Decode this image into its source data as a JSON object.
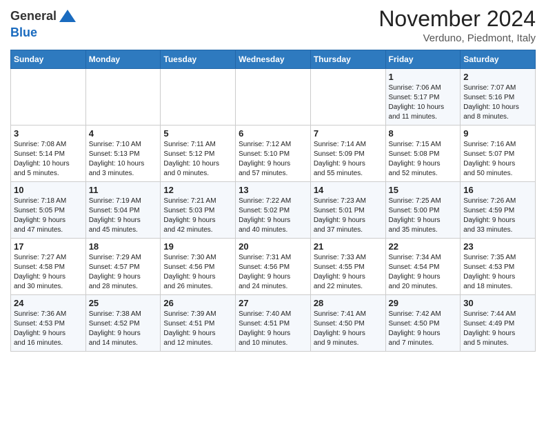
{
  "header": {
    "logo_general": "General",
    "logo_blue": "Blue",
    "month_title": "November 2024",
    "location": "Verduno, Piedmont, Italy"
  },
  "weekdays": [
    "Sunday",
    "Monday",
    "Tuesday",
    "Wednesday",
    "Thursday",
    "Friday",
    "Saturday"
  ],
  "weeks": [
    [
      {
        "day": "",
        "info": ""
      },
      {
        "day": "",
        "info": ""
      },
      {
        "day": "",
        "info": ""
      },
      {
        "day": "",
        "info": ""
      },
      {
        "day": "",
        "info": ""
      },
      {
        "day": "1",
        "info": "Sunrise: 7:06 AM\nSunset: 5:17 PM\nDaylight: 10 hours\nand 11 minutes."
      },
      {
        "day": "2",
        "info": "Sunrise: 7:07 AM\nSunset: 5:16 PM\nDaylight: 10 hours\nand 8 minutes."
      }
    ],
    [
      {
        "day": "3",
        "info": "Sunrise: 7:08 AM\nSunset: 5:14 PM\nDaylight: 10 hours\nand 5 minutes."
      },
      {
        "day": "4",
        "info": "Sunrise: 7:10 AM\nSunset: 5:13 PM\nDaylight: 10 hours\nand 3 minutes."
      },
      {
        "day": "5",
        "info": "Sunrise: 7:11 AM\nSunset: 5:12 PM\nDaylight: 10 hours\nand 0 minutes."
      },
      {
        "day": "6",
        "info": "Sunrise: 7:12 AM\nSunset: 5:10 PM\nDaylight: 9 hours\nand 57 minutes."
      },
      {
        "day": "7",
        "info": "Sunrise: 7:14 AM\nSunset: 5:09 PM\nDaylight: 9 hours\nand 55 minutes."
      },
      {
        "day": "8",
        "info": "Sunrise: 7:15 AM\nSunset: 5:08 PM\nDaylight: 9 hours\nand 52 minutes."
      },
      {
        "day": "9",
        "info": "Sunrise: 7:16 AM\nSunset: 5:07 PM\nDaylight: 9 hours\nand 50 minutes."
      }
    ],
    [
      {
        "day": "10",
        "info": "Sunrise: 7:18 AM\nSunset: 5:05 PM\nDaylight: 9 hours\nand 47 minutes."
      },
      {
        "day": "11",
        "info": "Sunrise: 7:19 AM\nSunset: 5:04 PM\nDaylight: 9 hours\nand 45 minutes."
      },
      {
        "day": "12",
        "info": "Sunrise: 7:21 AM\nSunset: 5:03 PM\nDaylight: 9 hours\nand 42 minutes."
      },
      {
        "day": "13",
        "info": "Sunrise: 7:22 AM\nSunset: 5:02 PM\nDaylight: 9 hours\nand 40 minutes."
      },
      {
        "day": "14",
        "info": "Sunrise: 7:23 AM\nSunset: 5:01 PM\nDaylight: 9 hours\nand 37 minutes."
      },
      {
        "day": "15",
        "info": "Sunrise: 7:25 AM\nSunset: 5:00 PM\nDaylight: 9 hours\nand 35 minutes."
      },
      {
        "day": "16",
        "info": "Sunrise: 7:26 AM\nSunset: 4:59 PM\nDaylight: 9 hours\nand 33 minutes."
      }
    ],
    [
      {
        "day": "17",
        "info": "Sunrise: 7:27 AM\nSunset: 4:58 PM\nDaylight: 9 hours\nand 30 minutes."
      },
      {
        "day": "18",
        "info": "Sunrise: 7:29 AM\nSunset: 4:57 PM\nDaylight: 9 hours\nand 28 minutes."
      },
      {
        "day": "19",
        "info": "Sunrise: 7:30 AM\nSunset: 4:56 PM\nDaylight: 9 hours\nand 26 minutes."
      },
      {
        "day": "20",
        "info": "Sunrise: 7:31 AM\nSunset: 4:56 PM\nDaylight: 9 hours\nand 24 minutes."
      },
      {
        "day": "21",
        "info": "Sunrise: 7:33 AM\nSunset: 4:55 PM\nDaylight: 9 hours\nand 22 minutes."
      },
      {
        "day": "22",
        "info": "Sunrise: 7:34 AM\nSunset: 4:54 PM\nDaylight: 9 hours\nand 20 minutes."
      },
      {
        "day": "23",
        "info": "Sunrise: 7:35 AM\nSunset: 4:53 PM\nDaylight: 9 hours\nand 18 minutes."
      }
    ],
    [
      {
        "day": "24",
        "info": "Sunrise: 7:36 AM\nSunset: 4:53 PM\nDaylight: 9 hours\nand 16 minutes."
      },
      {
        "day": "25",
        "info": "Sunrise: 7:38 AM\nSunset: 4:52 PM\nDaylight: 9 hours\nand 14 minutes."
      },
      {
        "day": "26",
        "info": "Sunrise: 7:39 AM\nSunset: 4:51 PM\nDaylight: 9 hours\nand 12 minutes."
      },
      {
        "day": "27",
        "info": "Sunrise: 7:40 AM\nSunset: 4:51 PM\nDaylight: 9 hours\nand 10 minutes."
      },
      {
        "day": "28",
        "info": "Sunrise: 7:41 AM\nSunset: 4:50 PM\nDaylight: 9 hours\nand 9 minutes."
      },
      {
        "day": "29",
        "info": "Sunrise: 7:42 AM\nSunset: 4:50 PM\nDaylight: 9 hours\nand 7 minutes."
      },
      {
        "day": "30",
        "info": "Sunrise: 7:44 AM\nSunset: 4:49 PM\nDaylight: 9 hours\nand 5 minutes."
      }
    ]
  ]
}
